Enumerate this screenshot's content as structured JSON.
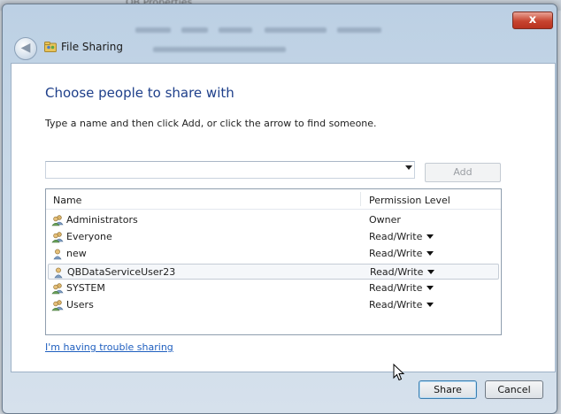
{
  "background": {
    "window_title": "QB Properties"
  },
  "window": {
    "title": "File Sharing",
    "close_label": "x"
  },
  "main": {
    "heading": "Choose people to share with",
    "instruction": "Type a name and then click Add, or click the arrow to find someone.",
    "name_input_value": "",
    "add_button": "Add"
  },
  "list": {
    "headers": {
      "name": "Name",
      "permission": "Permission Level"
    },
    "rows": [
      {
        "name": "Administrators",
        "permission": "Owner",
        "icon": "group-icon",
        "has_arrow": false
      },
      {
        "name": "Everyone",
        "permission": "Read/Write",
        "icon": "group-icon",
        "has_arrow": true
      },
      {
        "name": "new",
        "permission": "Read/Write",
        "icon": "user-icon",
        "has_arrow": true
      },
      {
        "name": "QBDataServiceUser23",
        "permission": "Read/Write",
        "icon": "user-icon",
        "has_arrow": true,
        "selected": true
      },
      {
        "name": "SYSTEM",
        "permission": "Read/Write",
        "icon": "group-icon",
        "has_arrow": true
      },
      {
        "name": "Users",
        "permission": "Read/Write",
        "icon": "group-icon",
        "has_arrow": true
      }
    ]
  },
  "links": {
    "trouble": "I'm having trouble sharing"
  },
  "buttons": {
    "share": "Share",
    "cancel": "Cancel"
  },
  "colors": {
    "heading": "#1e3f8a",
    "link": "#1f5fbf",
    "close": "#c7442f"
  }
}
